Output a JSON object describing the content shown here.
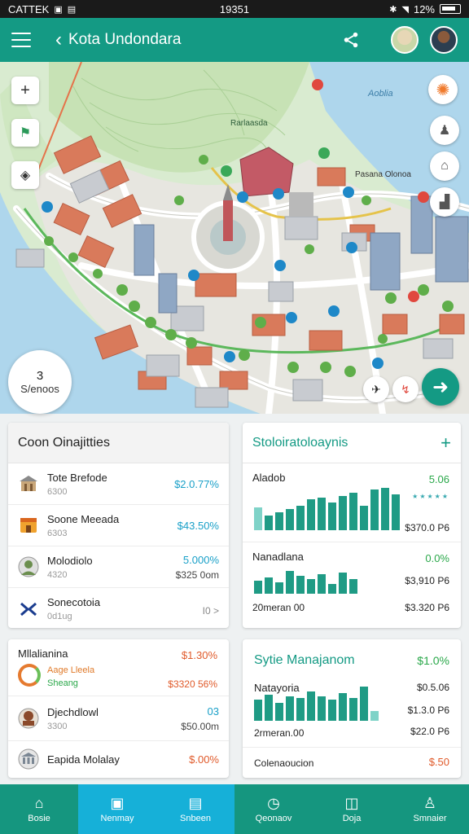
{
  "status_bar": {
    "left": "CATTEK",
    "time": "19351",
    "battery": "12%"
  },
  "app_bar": {
    "title": "Kota Undondara"
  },
  "map": {
    "stat_value": "3",
    "stat_label": "S/enoos",
    "district_label": "Aoblia",
    "street_label": "Rarlaasda",
    "road_label_1": "Pasana Olonoa"
  },
  "left_card": {
    "title": "Coon Oinajitties",
    "rows": [
      {
        "name": "Tote Brefode",
        "sub": "6300",
        "pct": "$2.0.77%",
        "sub2": ""
      },
      {
        "name": "Soone Meeada",
        "sub": "6303",
        "pct": "$43.50%",
        "sub2": ""
      },
      {
        "name": "Molodiolo",
        "sub": "4320",
        "pct": "5.000%",
        "sub2": "$325 0om"
      },
      {
        "name": "Sonecotoia",
        "sub": "0d1ug",
        "pct": "",
        "sub2": "I0 >"
      }
    ]
  },
  "right_card": {
    "title": "Stoloiratoloaynis",
    "items": [
      {
        "name": "Aladob",
        "pct": "5.06",
        "v1": "",
        "v2": "$370.0 P6",
        "sub": "",
        "stars": "★★★★★"
      },
      {
        "name": "Nanadlana",
        "pct": "0.0%",
        "v1": "$3,910 P6",
        "v2": "$3.320 P6",
        "sub": "20meran 00",
        "stars": ""
      }
    ]
  },
  "left_card2": {
    "head_title": "Mllalianina",
    "head_pct": "$1.30%",
    "head_sub1": "Aage Lleela",
    "head_sub2": "Sheang",
    "head_val": "$3320 56%",
    "rows": [
      {
        "name": "Djechdlowl",
        "sub": "3300",
        "pct": "03",
        "sub2": "$50.00m"
      },
      {
        "name": "Eapida Molalay",
        "sub": "",
        "pct": "$.00%",
        "sub2": ""
      }
    ]
  },
  "right_card2": {
    "title": "Sytie Manajanom",
    "pct": "$1.0%",
    "item_name": "Natayoria",
    "v1": "$0.5.06",
    "v2": "$1.3.0 P6",
    "v3": "$22.0 P6",
    "sub": "2rmeran.00",
    "bottom_name": "Colenaoucion",
    "bottom_val": "$.50"
  },
  "bottom_nav": {
    "items": [
      {
        "label": "Bosie",
        "icon": "home-icon"
      },
      {
        "label": "Nenmay",
        "icon": "doc-icon"
      },
      {
        "label": "Snbeen",
        "icon": "calendar-icon"
      },
      {
        "label": "Qeonaov",
        "icon": "clock-icon"
      },
      {
        "label": "Doja",
        "icon": "bag-icon"
      },
      {
        "label": "Smnaier",
        "icon": "profile-icon"
      }
    ]
  },
  "colors": {
    "primary": "#149a84",
    "accent": "#16b0d8"
  }
}
